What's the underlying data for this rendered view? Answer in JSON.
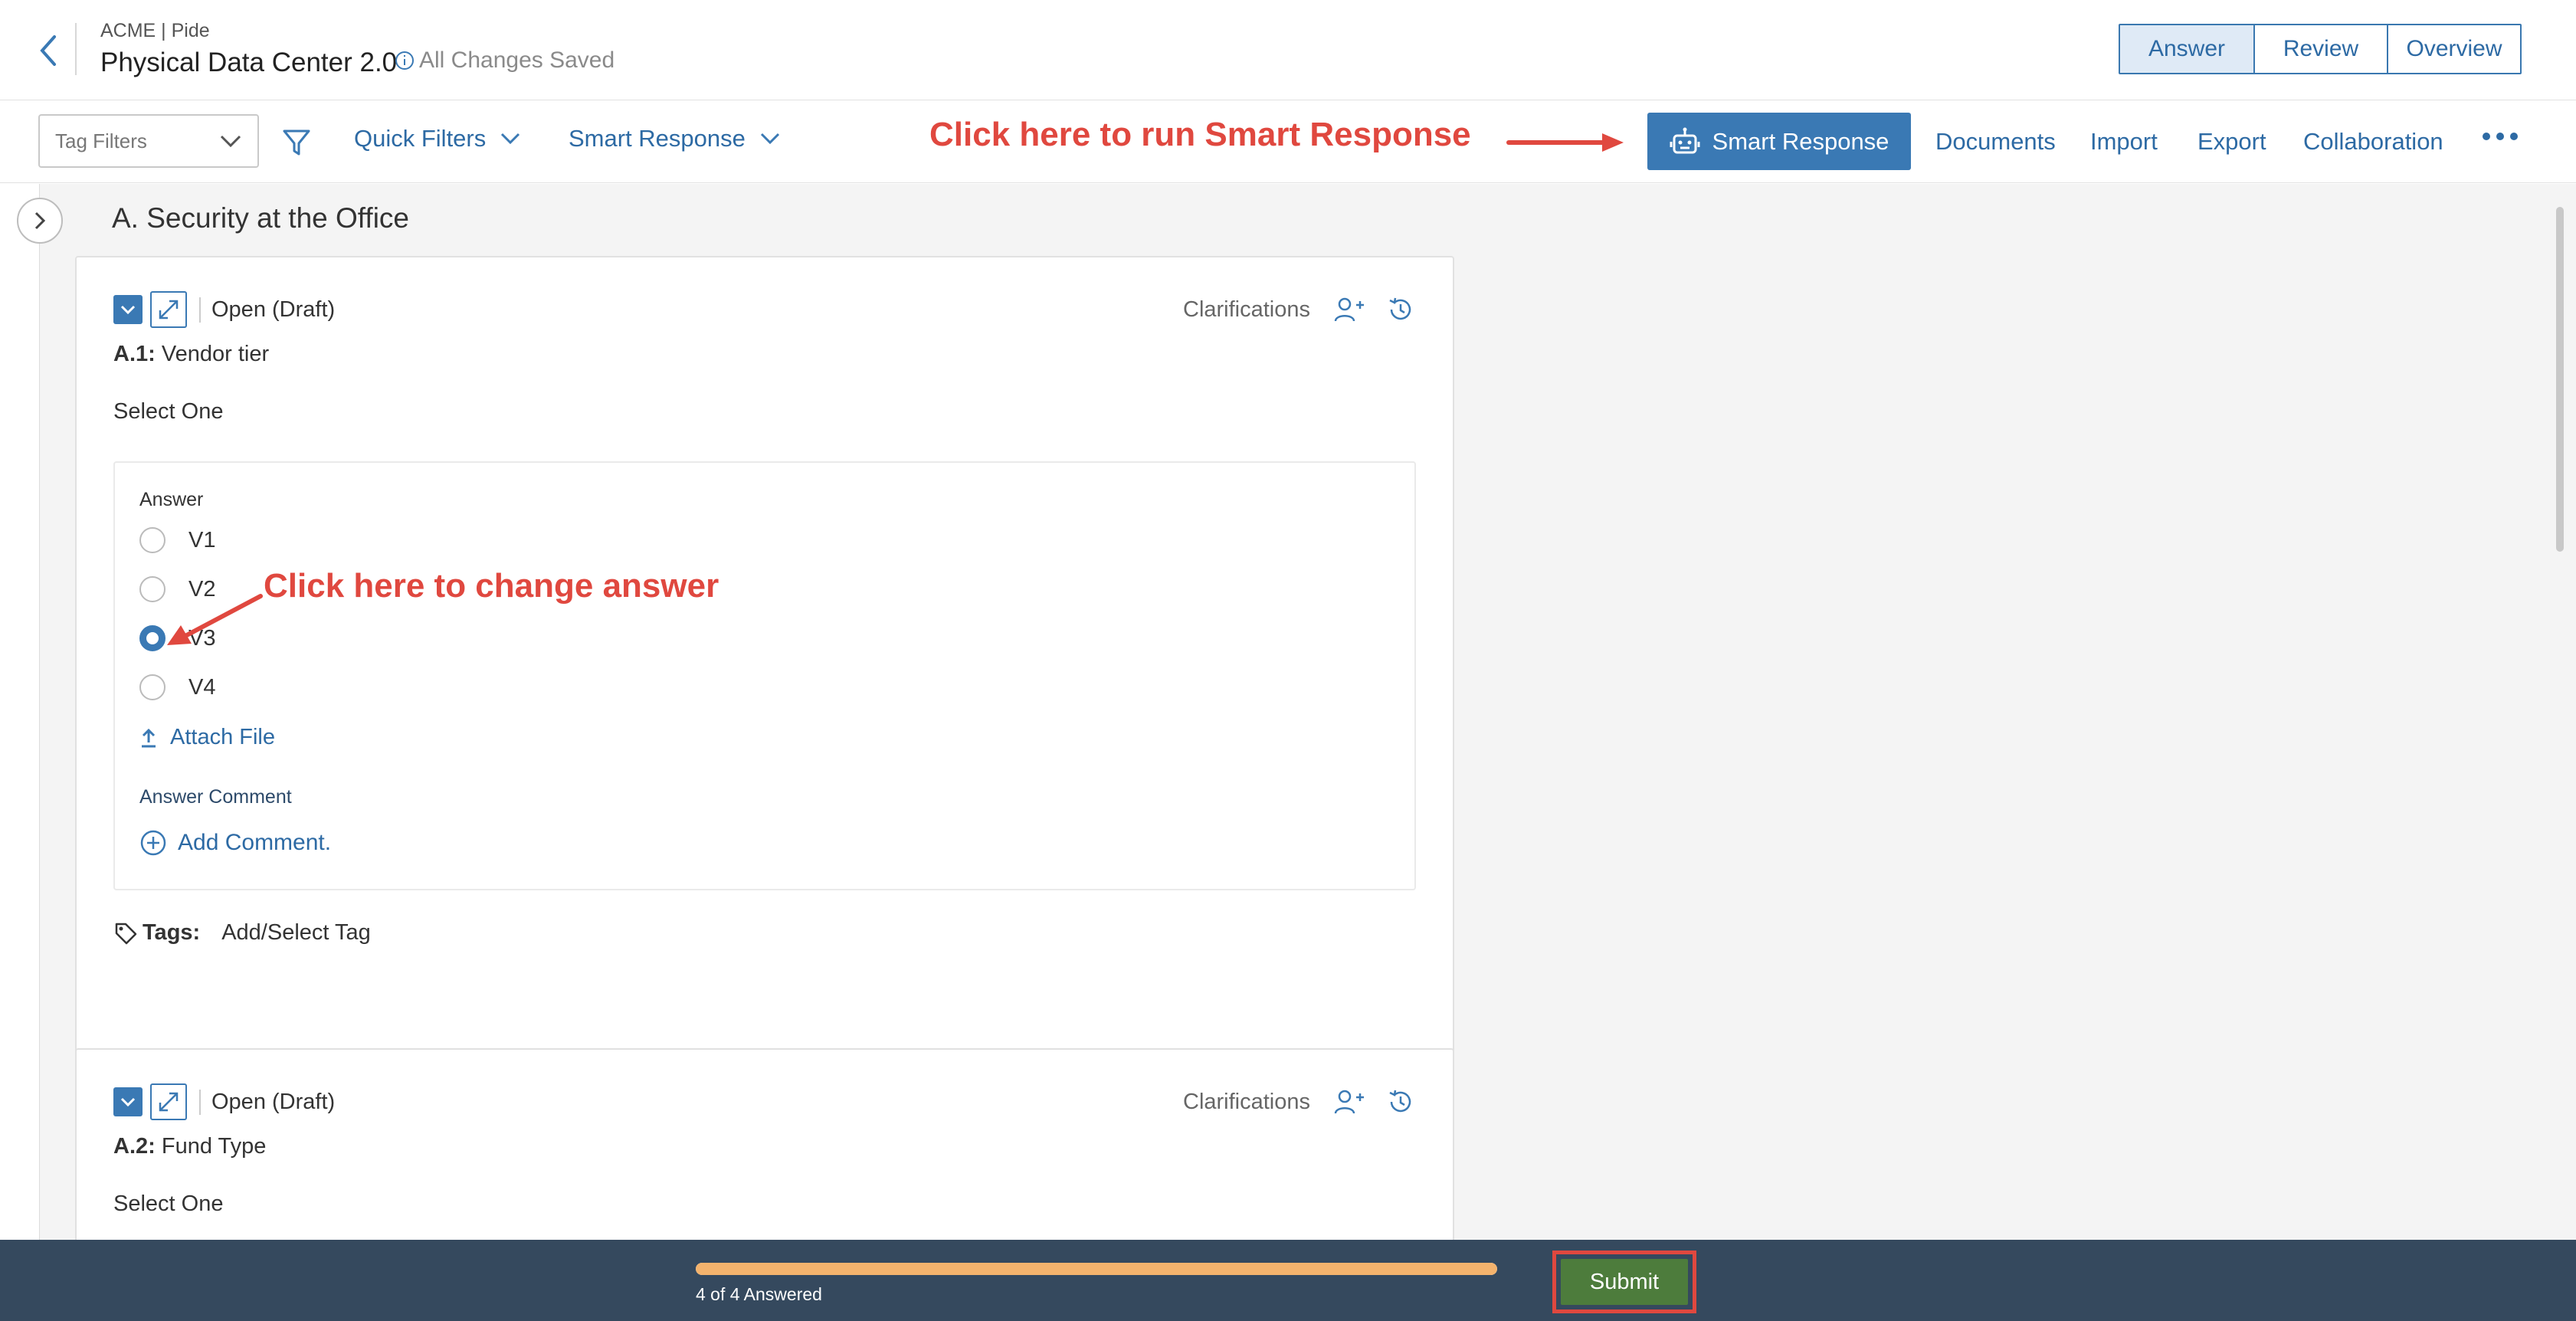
{
  "header": {
    "org": "ACME | Pide",
    "title": "Physical Data Center 2.0",
    "save_status": "All Changes Saved",
    "view_tabs": [
      "Answer",
      "Review",
      "Overview"
    ]
  },
  "toolbar": {
    "tag_filters_placeholder": "Tag Filters",
    "quick_filters": "Quick Filters",
    "smart_response_menu": "Smart Response",
    "smart_response_button": "Smart Response",
    "links": [
      "Documents",
      "Import",
      "Export",
      "Collaboration"
    ]
  },
  "annotations": {
    "run_smart_response": "Click here to run Smart Response",
    "change_answer": "Click here to change answer"
  },
  "section": {
    "title": "A. Security at the Office"
  },
  "questions": [
    {
      "status": "Open (Draft)",
      "clarifications": "Clarifications",
      "id": "A.1:",
      "text": "Vendor tier",
      "type": "Select One",
      "answer_label": "Answer",
      "options": [
        "V1",
        "V2",
        "V3",
        "V4"
      ],
      "selected": "V3",
      "attach": "Attach File",
      "comment_label": "Answer Comment",
      "add_comment": "Add Comment.",
      "tags_label": "Tags:",
      "tags_action": "Add/Select Tag"
    },
    {
      "status": "Open (Draft)",
      "clarifications": "Clarifications",
      "id": "A.2:",
      "text": "Fund Type",
      "type": "Select One"
    }
  ],
  "footer": {
    "progress_text": "4 of 4 Answered",
    "progress_fraction": 1.0,
    "submit": "Submit"
  },
  "colors": {
    "primary": "#3a79b4",
    "annotation": "#e0483f",
    "progress": "#f4b36d",
    "submit": "#4d7c3c",
    "footer_bg": "#35495e"
  }
}
